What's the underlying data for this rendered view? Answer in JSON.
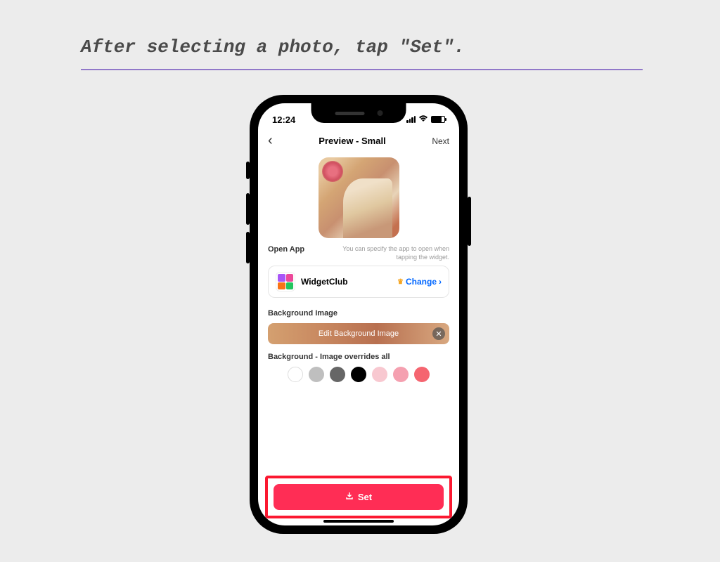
{
  "instruction": "After selecting a photo, tap \"Set\".",
  "status": {
    "time": "12:24"
  },
  "nav": {
    "title": "Preview - Small",
    "next": "Next"
  },
  "openApp": {
    "label": "Open App",
    "hint": "You can specify the app to open when tapping the widget.",
    "appName": "WidgetClub",
    "changeLabel": "Change"
  },
  "backgroundImage": {
    "label": "Background Image",
    "editLabel": "Edit Background Image"
  },
  "backgroundColors": {
    "label": "Background - Image overrides all",
    "swatches": [
      "#ffffff",
      "#bfbfbf",
      "#666666",
      "#000000",
      "#f8c8d0",
      "#f5a0b0",
      "#f56570"
    ]
  },
  "setButton": {
    "label": "Set"
  }
}
